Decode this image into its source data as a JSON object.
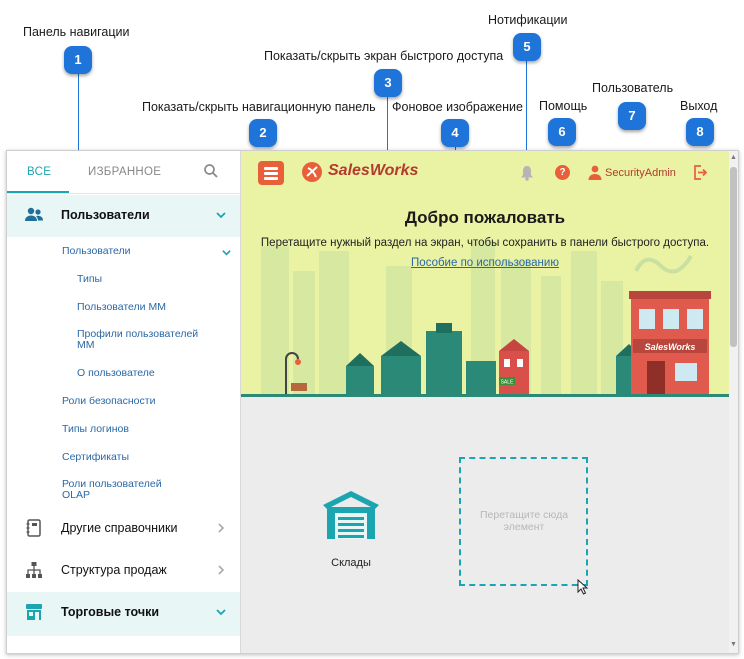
{
  "annotations": [
    {
      "num": "1",
      "label": "Панель навигации"
    },
    {
      "num": "2",
      "label": "Показать/скрыть навигационную панель"
    },
    {
      "num": "3",
      "label": "Показать/скрыть экран быстрого доступа"
    },
    {
      "num": "4",
      "label": "Фоновое изображение"
    },
    {
      "num": "5",
      "label": "Нотификации"
    },
    {
      "num": "6",
      "label": "Помощь"
    },
    {
      "num": "7",
      "label": "Пользователь"
    },
    {
      "num": "8",
      "label": "Выход"
    }
  ],
  "sidebar": {
    "tabs": {
      "all": "ВСЕ",
      "favorites": "ИЗБРАННОЕ"
    },
    "groups": [
      {
        "label": "Пользователи",
        "icon": "users-icon",
        "expanded": true
      },
      {
        "label": "Другие справочники",
        "icon": "notebook-icon"
      },
      {
        "label": "Структура продаж",
        "icon": "hierarchy-icon"
      },
      {
        "label": "Торговые точки",
        "icon": "store-icon",
        "expanded": true
      }
    ],
    "users_items": [
      "Пользователи",
      "Типы",
      "Пользователи ММ",
      "Профили пользователей ММ",
      "О пользователе",
      "Роли безопасности",
      "Типы логинов",
      "Сертификаты",
      "Роли пользователей OLAP"
    ]
  },
  "header": {
    "brand": "SalesWorks",
    "help_symbol": "?",
    "user_name": "SecurityAdmin"
  },
  "hero": {
    "title": "Добро пожаловать",
    "subtitle": "Перетащите нужный раздел на экран, чтобы сохранить в панели быстрого доступа.",
    "link": "Пособие по использованию",
    "store_sign": "SalesWorks",
    "sale_sign": "SALE"
  },
  "quick_access": {
    "tile_label": "Склады",
    "drop_text": "Перетащите сюда элемент"
  },
  "colors": {
    "accent": "#1aa5b0",
    "brand": "#e8603a",
    "annotation": "#1e74d8",
    "hero_bg": "#eaf3a4"
  }
}
